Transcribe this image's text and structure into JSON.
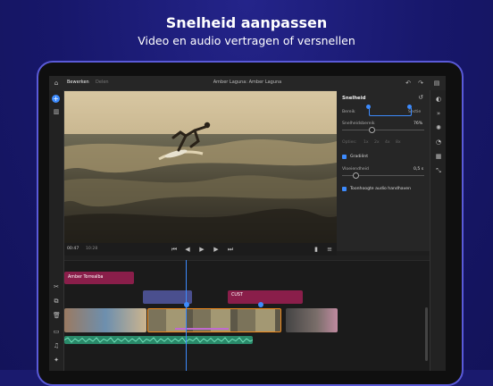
{
  "headline": "Snelheid aanpassen",
  "subline": "Video en audio vertragen of versnellen",
  "app": {
    "tabs": [
      "Bewerken",
      "Delen"
    ],
    "title": "Amber Laguna: Amber Laguna"
  },
  "panel": {
    "title": "Snelheid",
    "bereik_label": "Bereik",
    "sectie_label": "Sectie",
    "speed_label": "Snelheidsbereik",
    "speed_value": "76%",
    "speed_fraction": 0.76,
    "preset_label": "Opties:",
    "presets": [
      "1x",
      "2x",
      "4x",
      "8x"
    ],
    "gradient_label": "Gradiënt",
    "smoothness_label": "Vloeiendheid",
    "smoothness_value": "0,5 s",
    "pitch_label": "Toonhoogte audio handhaven"
  },
  "transport": {
    "current_time": "00:47",
    "total_time": "10:28"
  },
  "timeline": {
    "title_clip": "Amber Torrealba",
    "cust_clip": "CUST"
  },
  "colors": {
    "accent": "#3d8bfd",
    "title_clip": "#8a1e4a",
    "selection": "#f08a1c"
  }
}
